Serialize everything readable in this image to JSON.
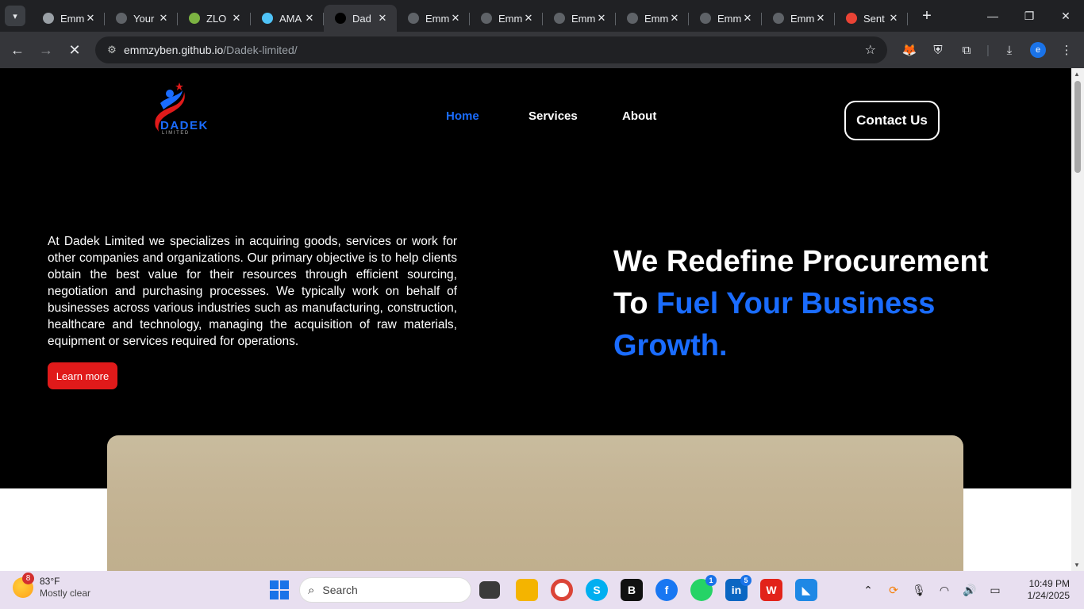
{
  "browser": {
    "tabs": [
      {
        "title": "Emm",
        "favicon_color": "#9aa0a6",
        "active": false
      },
      {
        "title": "Your",
        "favicon_color": "#5f6368",
        "active": false
      },
      {
        "title": "ZLO",
        "favicon_color": "#7cb342",
        "active": false
      },
      {
        "title": "AMA",
        "favicon_color": "#4fc3f7",
        "active": false
      },
      {
        "title": "Dad",
        "favicon_color": "#000000",
        "active": true
      },
      {
        "title": "Emm",
        "favicon_color": "#5f6368",
        "active": false
      },
      {
        "title": "Emm",
        "favicon_color": "#5f6368",
        "active": false
      },
      {
        "title": "Emm",
        "favicon_color": "#5f6368",
        "active": false
      },
      {
        "title": "Emm",
        "favicon_color": "#5f6368",
        "active": false
      },
      {
        "title": "Emm",
        "favicon_color": "#5f6368",
        "active": false
      },
      {
        "title": "Emm",
        "favicon_color": "#5f6368",
        "active": false
      },
      {
        "title": "Sent",
        "favicon_color": "#ea4335",
        "active": false
      }
    ],
    "url_host": "emmzyben.github.io",
    "url_path": "/Dadek-limited/"
  },
  "site": {
    "logo_text": "DADEK",
    "logo_sub": "LIMITED",
    "nav": {
      "home": "Home",
      "services": "Services",
      "about": "About"
    },
    "contact_label": "Contact Us",
    "intro": "At Dadek Limited we specializes in acquiring goods, services or work for other companies and organizations. Our primary objective is to help clients obtain the best value for their resources through efficient sourcing, negotiation and purchasing processes. We typically work on behalf of businesses across various industries such as manufacturing, construction, healthcare and technology, managing the acquisition of raw materials, equipment or services required for operations.",
    "learn_more": "Learn more",
    "headline_white": "We Redefine Procurement To ",
    "headline_blue": "Fuel Your Business Growth.",
    "accent_color": "#1a6cff",
    "button_red": "#e01a1a"
  },
  "taskbar": {
    "weather_temp": "83°F",
    "weather_desc": "Mostly clear",
    "weather_badge": "8",
    "search_label": "Search",
    "whatsapp_badge": "1",
    "linkedin_badge": "5",
    "time": "10:49 PM",
    "date": "1/24/2025"
  }
}
